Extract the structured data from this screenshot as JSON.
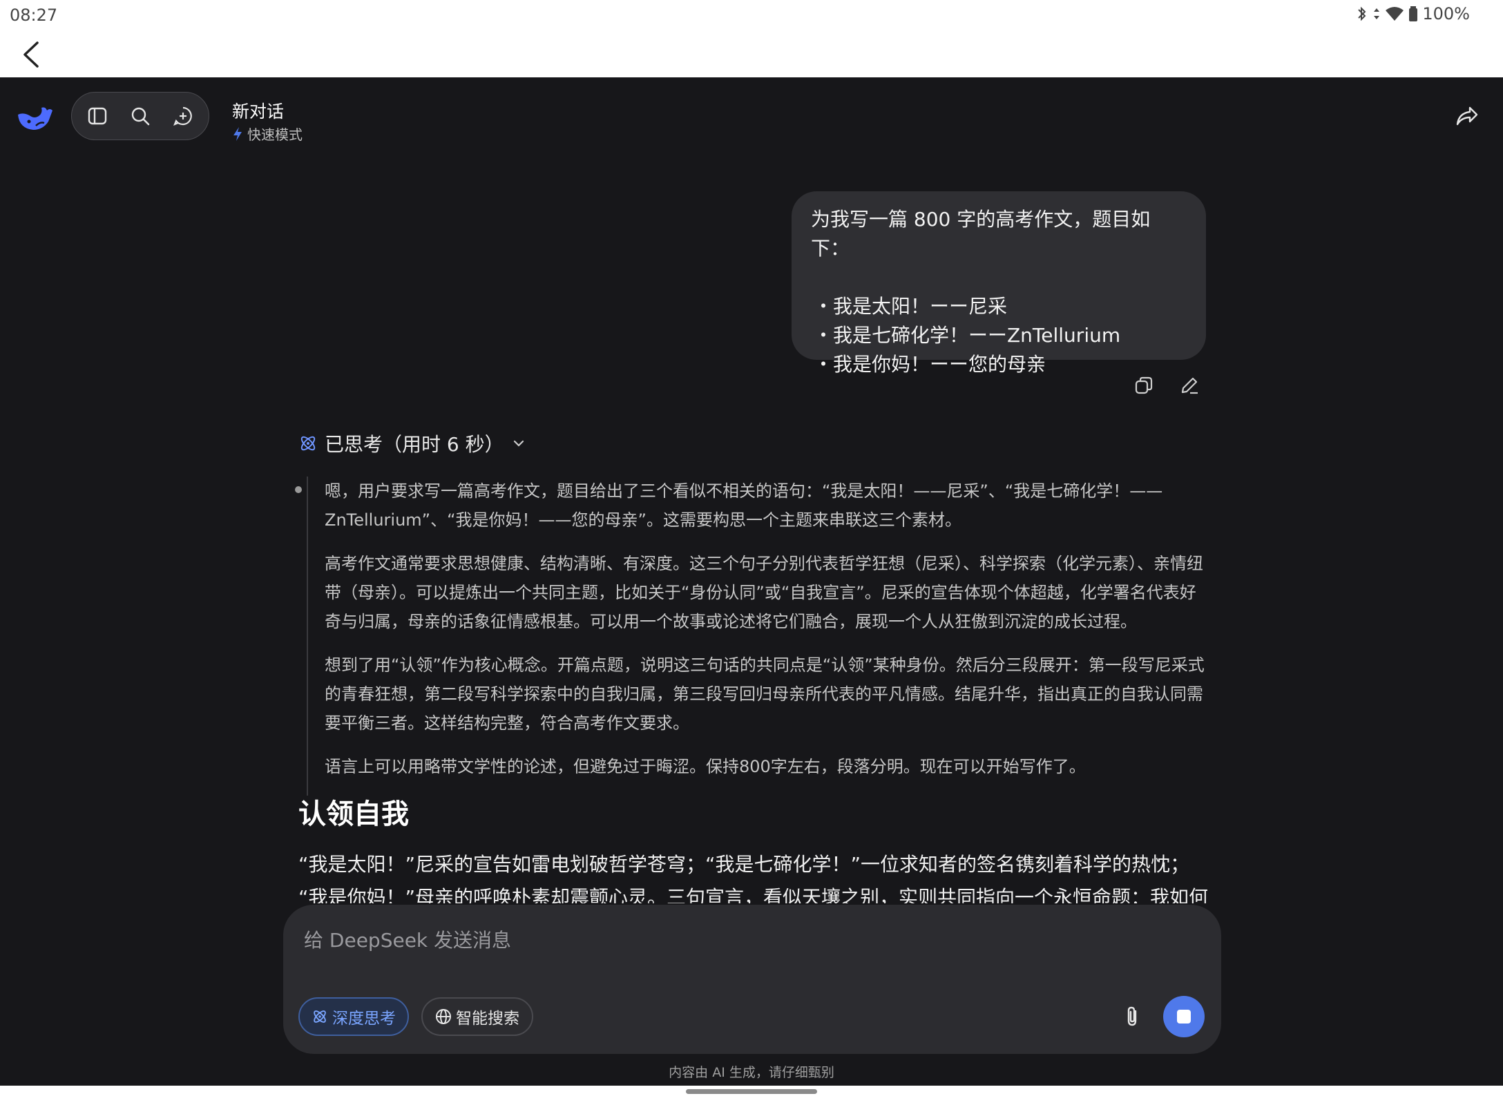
{
  "status": {
    "time": "08:27",
    "battery": "100%"
  },
  "header": {
    "title": "新对话",
    "mode": "快速模式"
  },
  "user_message": {
    "line1": "为我写一篇 800 字的高考作文，题目如下：",
    "bullets": [
      "・我是太阳！ーー尼采",
      "・我是七碲化学！ーーZnTellurium",
      "・我是你妈！ーー您的母亲"
    ]
  },
  "thinking": {
    "header": "已思考（用时 6 秒）",
    "paragraphs": [
      "嗯，用户要求写一篇高考作文，题目给出了三个看似不相关的语句：“我是太阳！——尼采”、“我是七碲化学！——ZnTellurium”、“我是你妈！——您的母亲”。这需要构思一个主题来串联这三个素材。",
      "高考作文通常要求思想健康、结构清晰、有深度。这三个句子分别代表哲学狂想（尼采）、科学探索（化学元素）、亲情纽带（母亲）。可以提炼出一个共同主题，比如关于“身份认同”或“自我宣言”。尼采的宣告体现个体超越，化学署名代表好奇与归属，母亲的话象征情感根基。可以用一个故事或论述将它们融合，展现一个人从狂傲到沉淀的成长过程。",
      "想到了用“认领”作为核心概念。开篇点题，说明这三句话的共同点是“认领”某种身份。然后分三段展开：第一段写尼采式的青春狂想，第二段写科学探索中的自我归属，第三段写回归母亲所代表的平凡情感。结尾升华，指出真正的自我认同需要平衡三者。这样结构完整，符合高考作文要求。",
      "语言上可以用略带文学性的论述，但避免过于晦涩。保持800字左右，段落分明。现在可以开始写作了。"
    ]
  },
  "answer": {
    "title": "认领自我",
    "line1": "“我是太阳！”尼采的宣告如雷电划破哲学苍穹；“我是七碲化学！”一位求知者的签名镌刻着科学的热忱；",
    "line2": "“我是你妈！”母亲的呼唤朴素却震颤心灵。三句宣言，看似天壤之别，实则共同指向一个永恒命题：我如何"
  },
  "composer": {
    "placeholder": "给 DeepSeek 发送消息",
    "deep_think": "深度思考",
    "smart_search": "智能搜索"
  },
  "footer": {
    "note": "内容由 AI 生成，请仔细甄别"
  },
  "colors": {
    "accent": "#4f79ea",
    "background": "#17171a"
  }
}
